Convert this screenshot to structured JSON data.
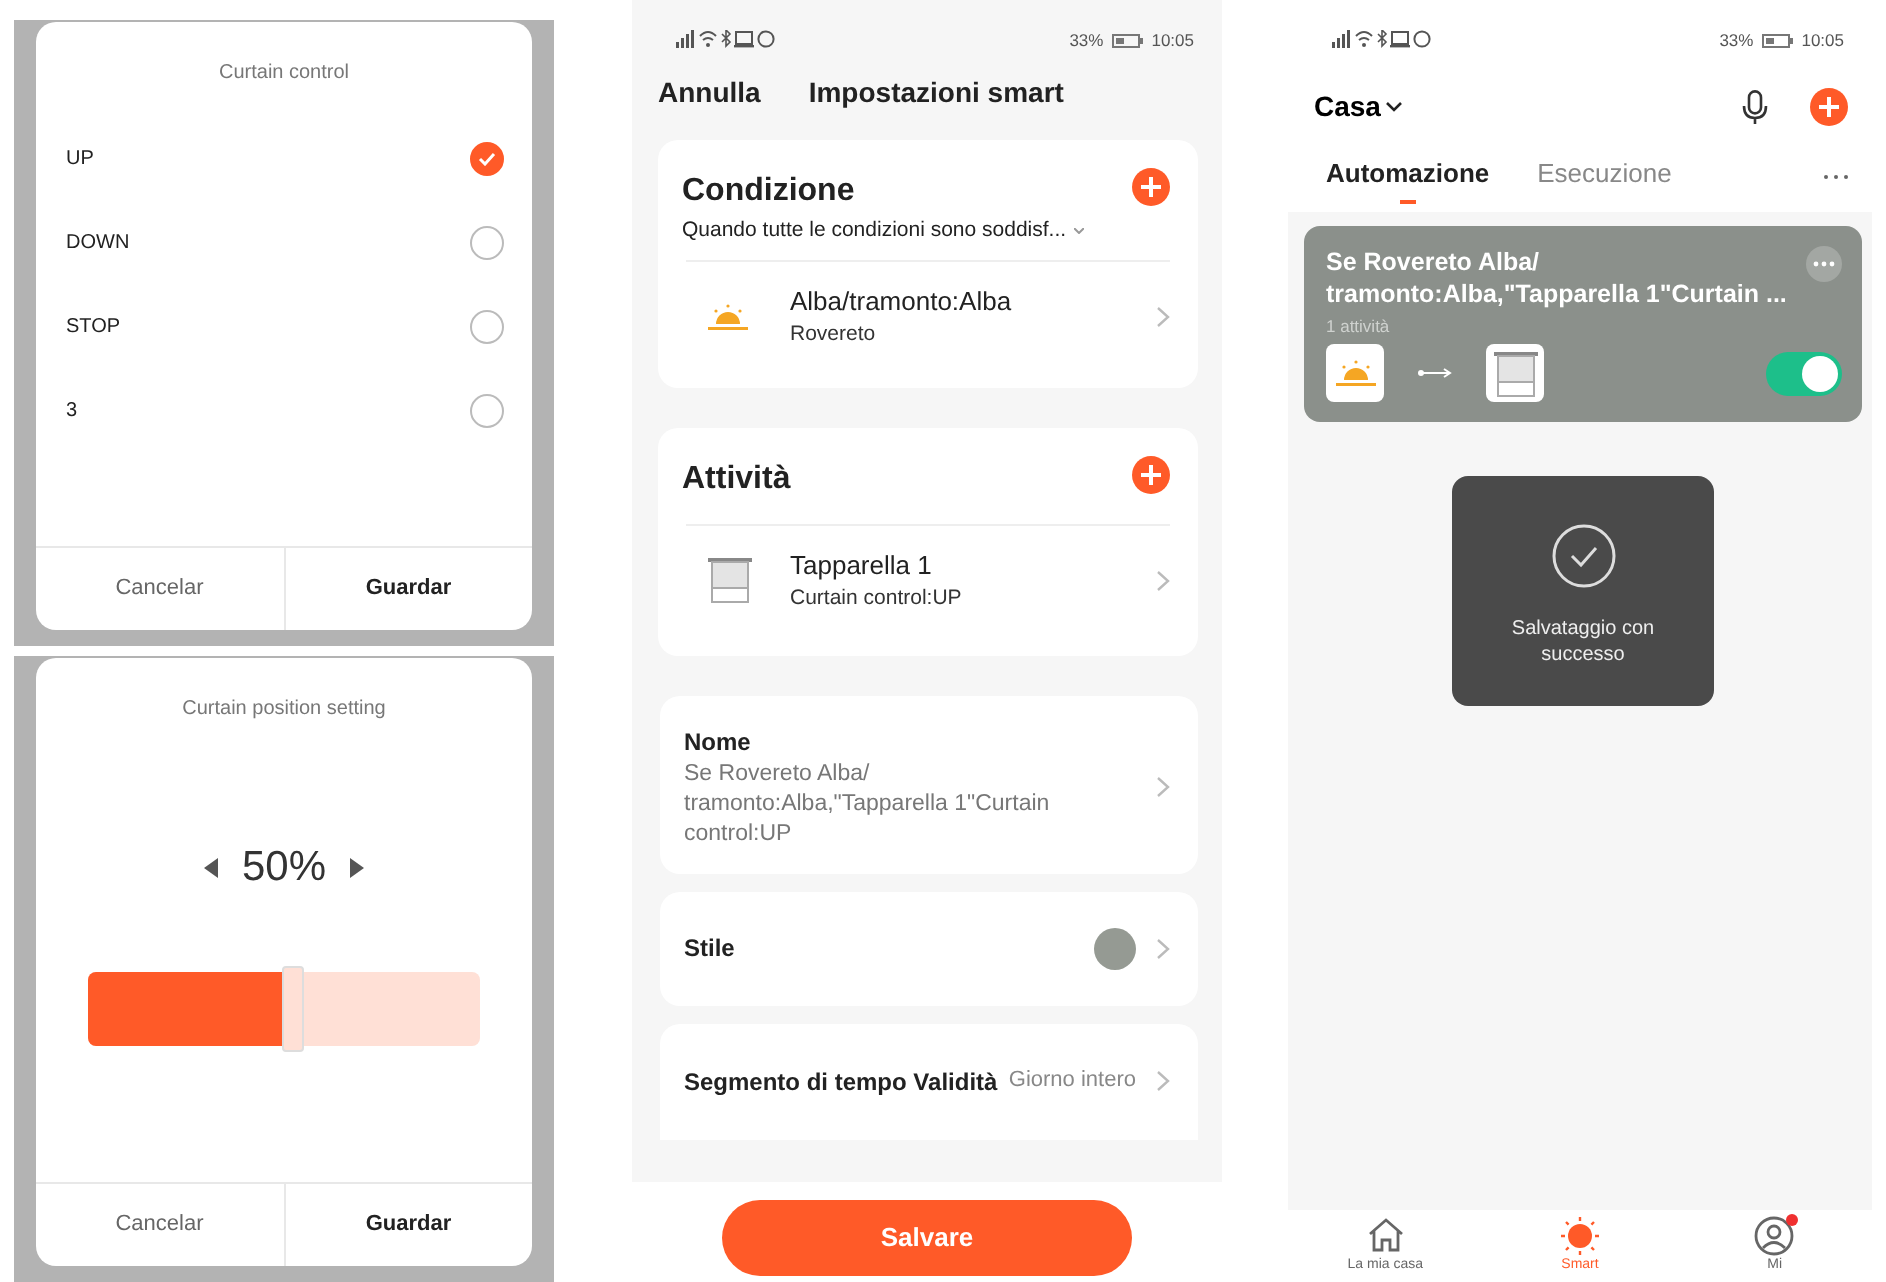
{
  "curtain_control_dialog": {
    "title": "Curtain control",
    "options": [
      {
        "label": "UP",
        "selected": true
      },
      {
        "label": "DOWN",
        "selected": false
      },
      {
        "label": "STOP",
        "selected": false
      },
      {
        "label": "3",
        "selected": false
      }
    ],
    "buttons": [
      {
        "label": "Cancelar",
        "kind": "cancel"
      },
      {
        "label": "Guardar",
        "kind": "confirm"
      }
    ]
  },
  "curtain_position_dialog": {
    "title": "Curtain position setting",
    "reading": "50%",
    "level": 0.5,
    "buttons": [
      {
        "label": "Cancelar",
        "kind": "cancel"
      },
      {
        "label": "Guardar",
        "kind": "confirm"
      }
    ]
  },
  "smart_settings": {
    "status_bar": {
      "battery": "33%",
      "time": "10:05"
    },
    "cancel": "Annulla",
    "title": "Impostazioni smart",
    "condition": {
      "title": "Condizione",
      "subtitle": "Quando tutte le condizioni sono soddisf...",
      "items": [
        {
          "kind": "sun",
          "title": "Alba/tramonto:Alba",
          "subtitle": "Rovereto"
        }
      ]
    },
    "activities": {
      "title": "Attività",
      "items": [
        {
          "kind": "curtain",
          "title": "Tapparella 1",
          "subtitle": "Curtain control:UP"
        }
      ]
    },
    "name": {
      "label": "Nome",
      "value": "Se Rovereto Alba/ tramonto:Alba,\"Tapparella 1\"Curtain control:UP"
    },
    "style": {
      "label": "Stile",
      "color": "#959a93"
    },
    "validity": {
      "label": "Segmento di tempo Validità",
      "value": "Giorno intero"
    },
    "save_button": "Salvare"
  },
  "smart_screen": {
    "status_bar": {
      "battery": "33%",
      "time": "10:05"
    },
    "home": "Casa",
    "tabs": [
      {
        "label": "Automazione",
        "selected": true
      },
      {
        "label": "Esecuzione",
        "selected": false
      }
    ],
    "automation": {
      "title": "Se Rovereto Alba/ tramonto:Alba,\"Tapparella 1\"Curtain ...",
      "count": "1 attività",
      "enabled": true
    },
    "toast": "Salvataggio con successo",
    "nav": [
      {
        "kind": "home",
        "label": "La mia casa",
        "selected": false,
        "notification": false
      },
      {
        "kind": "smart",
        "label": "Smart",
        "selected": true,
        "notification": false
      },
      {
        "kind": "profile",
        "label": "Mi",
        "selected": false,
        "notification": true
      }
    ]
  }
}
